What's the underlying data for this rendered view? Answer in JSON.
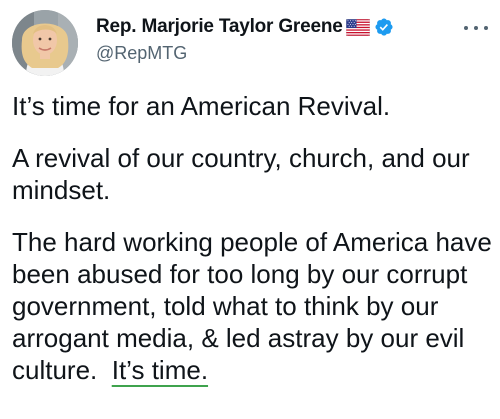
{
  "author": {
    "display_name": "Rep. Marjorie Taylor Greene",
    "flag_emoji": "us-flag-icon",
    "verified_icon": "verified-badge-icon",
    "handle": "@RepMTG",
    "verified_color": "#1d9bf0"
  },
  "more_menu_icon": "more-horizontal-icon",
  "tweet": {
    "paragraph_1": "It’s time for an American Revival.",
    "paragraph_2": "A revival of our country, church, and our mindset.",
    "paragraph_3_main": "The hard working people of America have been abused for too long by our corrupt government, told what to think by our arrogant media, & led astray by our evil culture.",
    "paragraph_3_end": "It’s time.",
    "underline_color": "#3fa34d"
  }
}
